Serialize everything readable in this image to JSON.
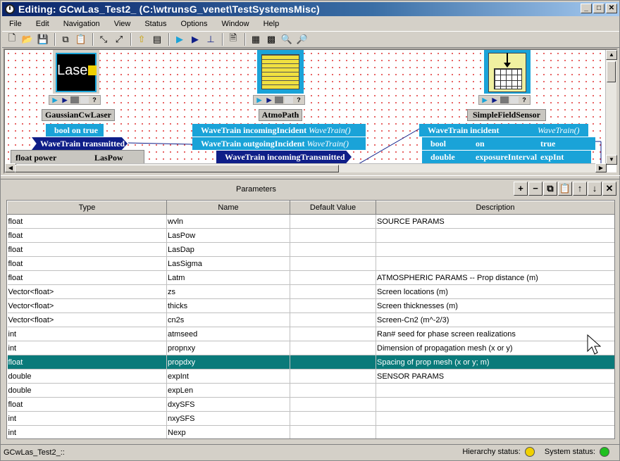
{
  "window": {
    "title": "Editing:  GCwLas_Test2_  (C:\\wtrunsG_venet\\TestSystemsMisc)"
  },
  "menu": [
    "File",
    "Edit",
    "Navigation",
    "View",
    "Status",
    "Options",
    "Window",
    "Help"
  ],
  "blocks": {
    "laser": {
      "name": "GaussianCwLaser",
      "icon_text": "Laser",
      "ports": {
        "bool_port": "bool on true",
        "out_port": "WaveTrain transmitted"
      },
      "param": {
        "type": "float power",
        "value": "LasPow"
      }
    },
    "atmo": {
      "name": "AtmoPath",
      "ports": {
        "in1_label": "WaveTrain incomingIncident",
        "in1_type": "WaveTrain()",
        "in2_label": "WaveTrain outgoingIncident",
        "in2_type": "WaveTrain()",
        "out_label": "WaveTrain incomingTransmitted"
      }
    },
    "sensor": {
      "name": "SimpleFieldSensor",
      "ports": {
        "in_label": "WaveTrain incident",
        "in_type": "WaveTrain()",
        "bool_type": "bool",
        "bool_name": "on",
        "bool_val": "true",
        "dbl_type": "double",
        "dbl_name": "exposureInterval",
        "dbl_val": "expInt"
      }
    }
  },
  "parameters": {
    "title": "Parameters",
    "toolbar": [
      "+",
      "−",
      "copy-icon",
      "paste-icon",
      "↑",
      "↓",
      "✕"
    ],
    "columns": [
      "Type",
      "Name",
      "Default Value",
      "Description"
    ],
    "rows": [
      [
        "float",
        "wvln",
        "",
        "SOURCE PARAMS"
      ],
      [
        "float",
        "LasPow",
        "",
        ""
      ],
      [
        "float",
        "LasDap",
        "",
        ""
      ],
      [
        "float",
        "LasSigma",
        "",
        ""
      ],
      [
        "float",
        "Latm",
        "",
        "ATMOSPHERIC PARAMS -- Prop distance (m)"
      ],
      [
        "Vector<float>",
        "zs",
        "",
        "Screen locations (m)"
      ],
      [
        "Vector<float>",
        "thicks",
        "",
        "Screen thicknesses (m)"
      ],
      [
        "Vector<float>",
        "cn2s",
        "",
        "Screen-Cn2 (m^-2/3)"
      ],
      [
        "int",
        "atmseed",
        "",
        "Ran# seed for phase screen realizations"
      ],
      [
        "int",
        "propnxy",
        "",
        "Dimension of propagation mesh (x or y)"
      ],
      [
        "float",
        "propdxy",
        "",
        "Spacing of prop mesh (x or y; m)"
      ],
      [
        "double",
        "expInt",
        "",
        "SENSOR PARAMS"
      ],
      [
        "double",
        "expLen",
        "",
        ""
      ],
      [
        "float",
        "dxySFS",
        "",
        ""
      ],
      [
        "int",
        "nxySFS",
        "",
        ""
      ],
      [
        "int",
        "Nexp",
        "",
        ""
      ]
    ],
    "selected_row": 10
  },
  "status": {
    "left": "GCwLas_Test2_::",
    "hierarchy_label": "Hierarchy status:",
    "hierarchy_color": "#f0d000",
    "system_label": "System status:",
    "system_color": "#20c020"
  }
}
